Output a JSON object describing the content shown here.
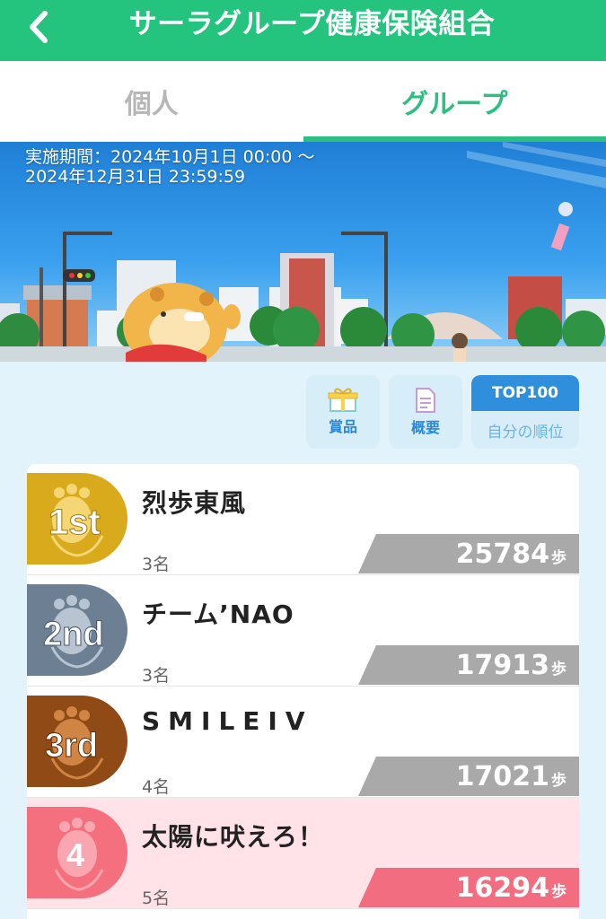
{
  "header": {
    "title": "サーラグループ健康保険組合"
  },
  "tabs": [
    {
      "label": "個人",
      "active": false
    },
    {
      "label": "グループ",
      "active": true
    }
  ],
  "banner": {
    "period_line1": "実施期間：2024年10月1日 00:00 ～",
    "period_line2": "2024年12月31日 23:59:59"
  },
  "actions": {
    "prize_label": "賞品",
    "summary_label": "概要",
    "top100_label": "TOP100",
    "my_rank_label": "自分の順位"
  },
  "ranking": [
    {
      "rank_text": "1st",
      "name": "烈歩東風",
      "members": "3名",
      "steps": "25784",
      "unit": "歩"
    },
    {
      "rank_text": "2nd",
      "name": "チーム’NAO",
      "members": "3名",
      "steps": "17913",
      "unit": "歩"
    },
    {
      "rank_text": "3rd",
      "name": "SMILEIV",
      "members": "4名",
      "steps": "17021",
      "unit": "歩"
    },
    {
      "rank_text": "4",
      "name": "太陽に吠えろ！",
      "members": "5名",
      "steps": "16294",
      "unit": "歩"
    }
  ],
  "colors": {
    "header_green": "#25c47e",
    "tab_active": "#2bbf82",
    "gold": "#d9aa1c",
    "silver": "#6d7f93",
    "bronze": "#8f4a16",
    "pink": "#f4707e",
    "button_blue": "#2f8fdc"
  }
}
